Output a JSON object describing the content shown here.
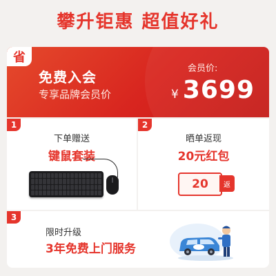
{
  "headline": "攀升钜惠 超值好礼",
  "promo": {
    "tag": "省",
    "title": "免费入会",
    "subtitle": "专享品牌会员价",
    "member_price_label": "会员价:",
    "currency": "¥",
    "price": "3699"
  },
  "benefits": [
    {
      "number": "1",
      "label": "下单赠送",
      "value": "键鼠套装"
    },
    {
      "number": "2",
      "label": "晒单返现",
      "value": "20元红包",
      "coupon_amount": "20",
      "coupon_tag": "返"
    },
    {
      "number": "3",
      "label": "限时升级",
      "value": "3年免费上门服务"
    }
  ],
  "colors": {
    "accent": "#e5352c",
    "background": "#f3f1ef",
    "promo_gradient_start": "#e54a2c",
    "promo_gradient_end": "#c51c19"
  },
  "icons": [
    "keyboard-mouse-image",
    "red-packet-coupon-icon",
    "service-van-image"
  ]
}
